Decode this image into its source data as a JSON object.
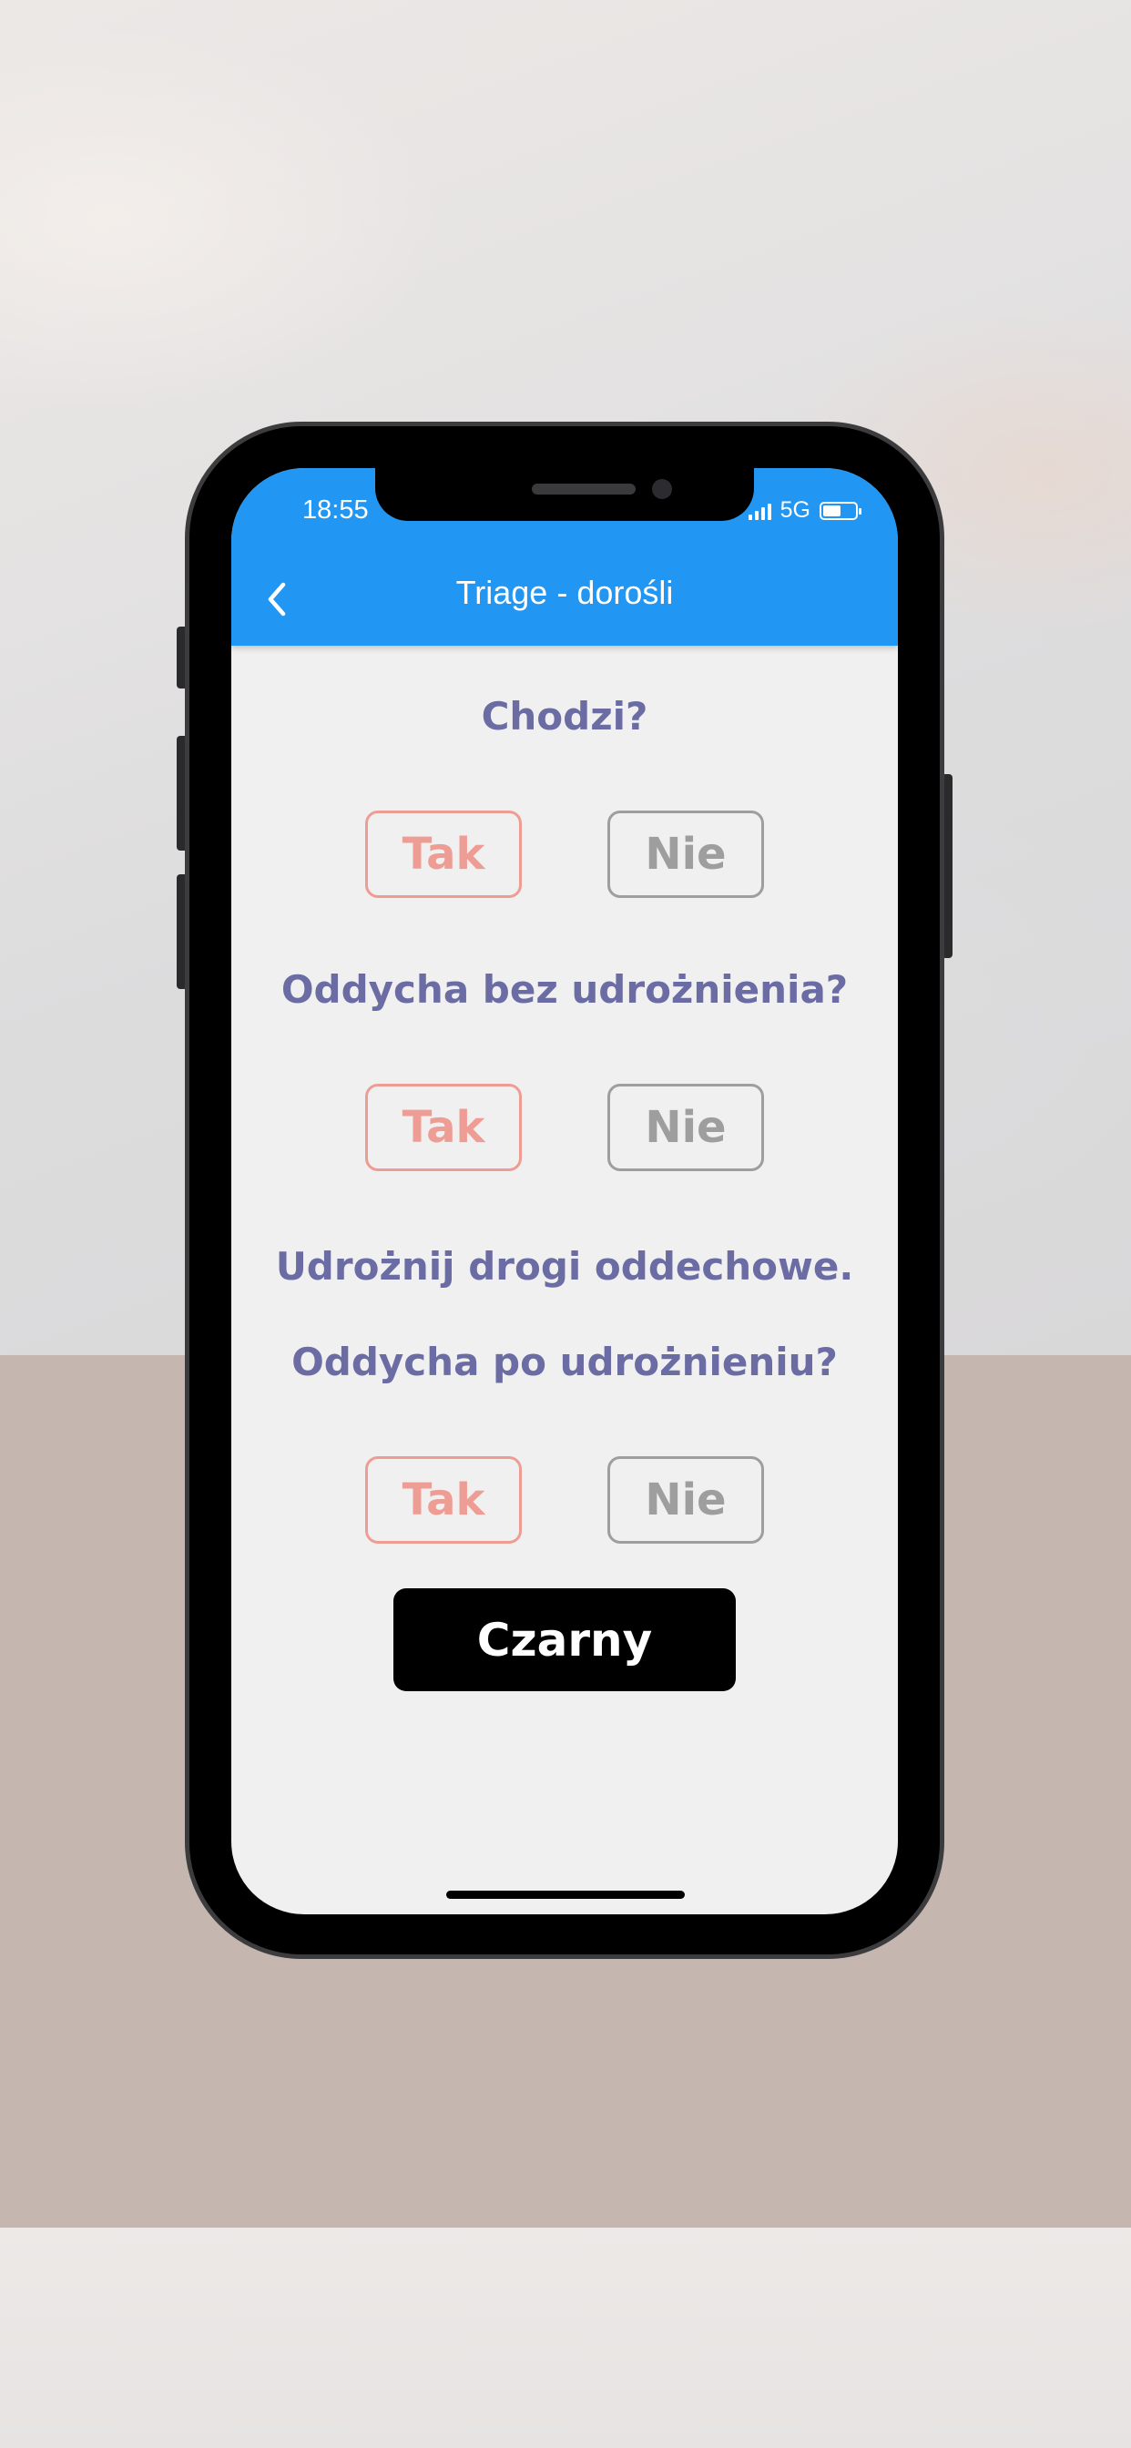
{
  "status_bar": {
    "time": "18:55",
    "network": "5G"
  },
  "app_bar": {
    "title": "Triage - dorośli",
    "back_icon": "chevron-left-icon",
    "color": "#2196f3"
  },
  "questions": [
    {
      "text": "Chodzi?",
      "yes_label": "Tak",
      "no_label": "Nie"
    },
    {
      "text": "Oddycha bez udrożnienia?",
      "yes_label": "Tak",
      "no_label": "Nie"
    },
    {
      "instruction": "Udrożnij drogi oddechowe.",
      "text": "Oddycha po udrożnieniu?",
      "yes_label": "Tak",
      "no_label": "Nie"
    }
  ],
  "result": {
    "label": "Czarny",
    "color": "#000000"
  },
  "colors": {
    "question_text": "#6b6ca3",
    "yes_accent": "#ee9d95",
    "no_accent": "#9e9e9e"
  }
}
